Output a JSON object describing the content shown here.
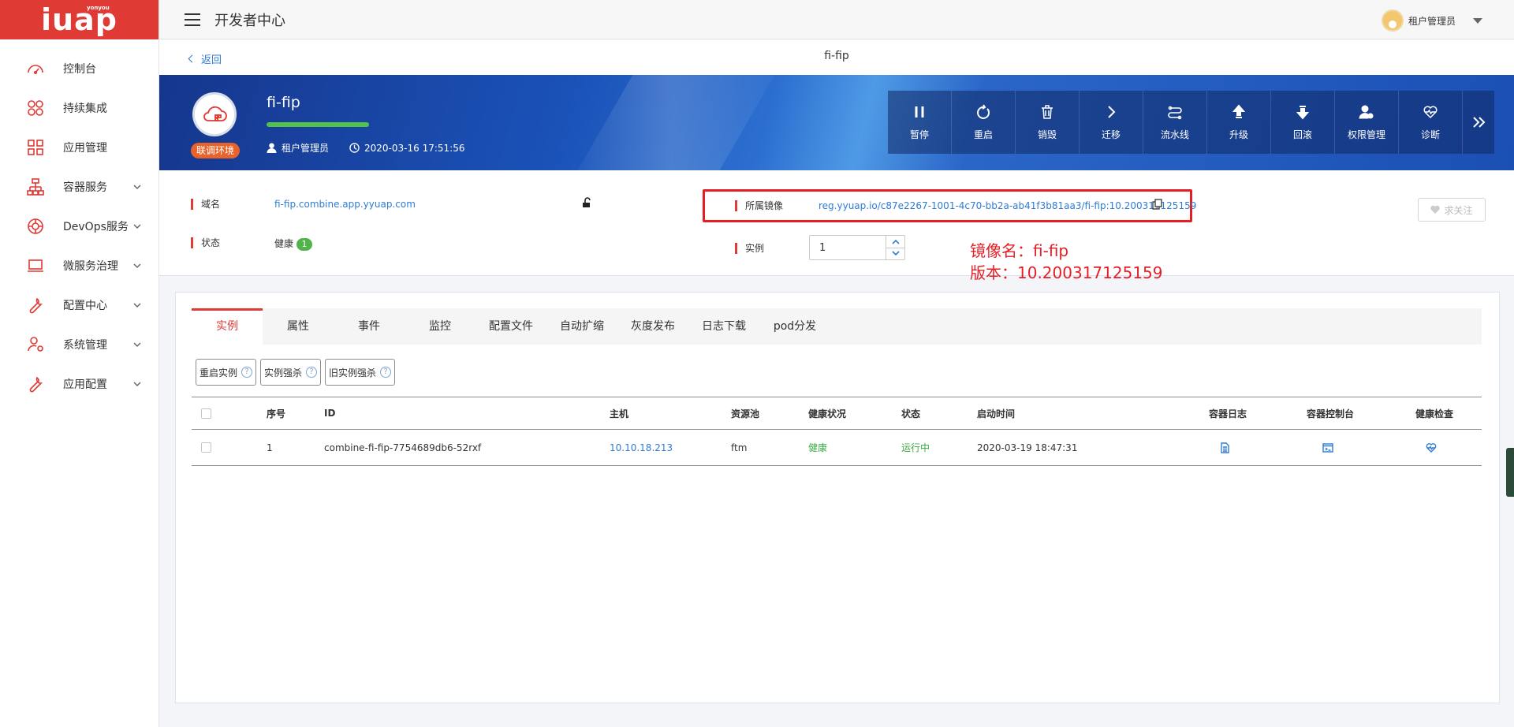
{
  "logo": {
    "text": "iuap",
    "sub": "yonyou"
  },
  "sidebar": {
    "items": [
      {
        "label": "控制台",
        "icon": "dashboard-icon",
        "expandable": false
      },
      {
        "label": "持续集成",
        "icon": "ci-icon",
        "expandable": false
      },
      {
        "label": "应用管理",
        "icon": "grid-icon",
        "expandable": false
      },
      {
        "label": "容器服务",
        "icon": "container-icon",
        "expandable": true
      },
      {
        "label": "DevOps服务",
        "icon": "devops-icon",
        "expandable": true
      },
      {
        "label": "微服务治理",
        "icon": "laptop-icon",
        "expandable": true
      },
      {
        "label": "配置中心",
        "icon": "wrench-icon",
        "expandable": true
      },
      {
        "label": "系统管理",
        "icon": "user-gear-icon",
        "expandable": true
      },
      {
        "label": "应用配置",
        "icon": "wrench-icon",
        "expandable": true
      }
    ]
  },
  "header": {
    "title": "开发者中心",
    "user_name": "租户管理员"
  },
  "crumb": {
    "back_label": "返回",
    "page_title": "fi-fip"
  },
  "banner": {
    "app_name": "fi-fip",
    "env_badge": "联调环境",
    "owner": "租户管理员",
    "created_at": "2020-03-16 17:51:56",
    "health_level": 1.0,
    "actions": [
      {
        "label": "暂停",
        "icon": "pause-icon"
      },
      {
        "label": "重启",
        "icon": "restart-icon"
      },
      {
        "label": "销毁",
        "icon": "trash-icon"
      },
      {
        "label": "迁移",
        "icon": "chevron-right-icon"
      },
      {
        "label": "流水线",
        "icon": "pipeline-icon"
      },
      {
        "label": "升级",
        "icon": "upgrade-icon"
      },
      {
        "label": "回滚",
        "icon": "rollback-icon"
      },
      {
        "label": "权限管理",
        "icon": "permission-icon"
      },
      {
        "label": "诊断",
        "icon": "diagnose-icon"
      }
    ]
  },
  "info": {
    "domain_label": "域名",
    "domain_value": "fi-fip.combine.app.yyuap.com",
    "status_label": "状态",
    "status_value": "健康",
    "status_count": "1",
    "image_label": "所属镜像",
    "image_value": "reg.yyuap.io/c87e2267-1001-4c70-bb2a-ab41f3b81aa3/fi-fip:10.200317125159",
    "instance_label": "实例",
    "instance_value": "1",
    "annotation_line1": "镜像名：fi-fip",
    "annotation_line2": "版本：10.200317125159",
    "follow_label": "求关注"
  },
  "tabs": [
    "实例",
    "属性",
    "事件",
    "监控",
    "配置文件",
    "自动扩缩",
    "灰度发布",
    "日志下载",
    "pod分发"
  ],
  "toolbar": [
    {
      "label": "重启实例",
      "help": "?"
    },
    {
      "label": "实例强杀",
      "help": "?"
    },
    {
      "label": "旧实例强杀",
      "help": "?"
    }
  ],
  "table": {
    "columns": [
      "序号",
      "ID",
      "主机",
      "资源池",
      "健康状况",
      "状态",
      "启动时间",
      "容器日志",
      "容器控制台",
      "健康检查"
    ],
    "rows": [
      {
        "index": "1",
        "id": "combine-fi-fip-7754689db6-52rxf",
        "host": "10.10.18.213",
        "pool": "ftm",
        "health": "健康",
        "state": "运行中",
        "start_time": "2020-03-19 18:47:31"
      }
    ]
  },
  "colors": {
    "accent": "#e03a34",
    "link": "#2f7cd3",
    "ok": "#3aa845",
    "annotation": "#e51e25"
  }
}
